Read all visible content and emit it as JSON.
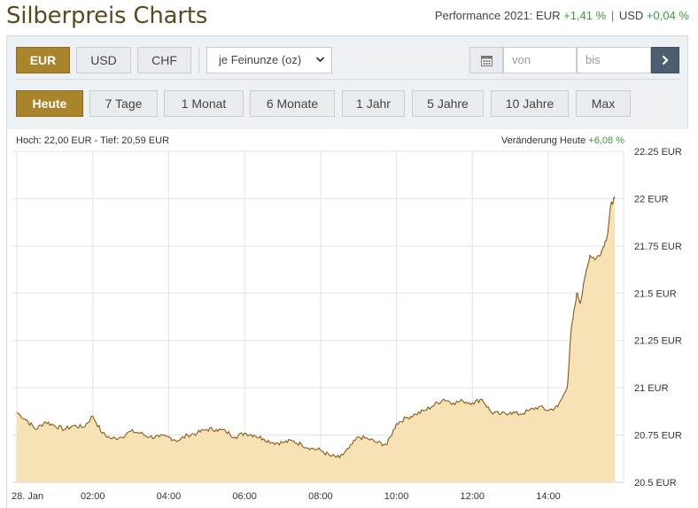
{
  "header": {
    "title": "Silberpreis Charts",
    "performance_label": "Performance 2021:",
    "eur_label": "EUR",
    "eur_value": "+1,41 %",
    "separator": "|",
    "usd_label": "USD",
    "usd_value": "+0,04 %"
  },
  "currency_buttons": [
    {
      "label": "EUR",
      "active": true
    },
    {
      "label": "USD",
      "active": false
    },
    {
      "label": "CHF",
      "active": false
    }
  ],
  "unit_select": {
    "value": "je Feinunze (oz)"
  },
  "date_range": {
    "from_placeholder": "von",
    "to_placeholder": "bis"
  },
  "range_buttons": [
    {
      "label": "Heute",
      "active": true
    },
    {
      "label": "7 Tage",
      "active": false
    },
    {
      "label": "1 Monat",
      "active": false
    },
    {
      "label": "6 Monate",
      "active": false
    },
    {
      "label": "1 Jahr",
      "active": false
    },
    {
      "label": "5 Jahre",
      "active": false
    },
    {
      "label": "10 Jahre",
      "active": false
    },
    {
      "label": "Max",
      "active": false
    }
  ],
  "colors": {
    "accent": "#a8852a",
    "line": "#8b5a1a",
    "fill": "#f6e2b4",
    "positive": "#3c9a3c"
  },
  "chart_data": {
    "type": "area",
    "hi_lo_text": "Hoch: 22,00 EUR - Tief: 20,59 EUR",
    "change_label": "Veränderung Heute",
    "change_value": "+6,08 %",
    "x_ticks": [
      "28. Jan",
      "02:00",
      "04:00",
      "06:00",
      "08:00",
      "10:00",
      "12:00",
      "14:00"
    ],
    "y_ticks": [
      "22.25 EUR",
      "22 EUR",
      "21.75 EUR",
      "21.5 EUR",
      "21.25 EUR",
      "21 EUR",
      "20.75 EUR",
      "20.5 EUR"
    ],
    "y_values": [
      22.25,
      22.0,
      21.75,
      21.5,
      21.25,
      21.0,
      20.75,
      20.5
    ],
    "x_hour_ticks": [
      0,
      2,
      4,
      6,
      8,
      10,
      12,
      14
    ],
    "xlim": [
      0,
      15.75
    ],
    "ylim": [
      20.5,
      22.25
    ],
    "grid": true,
    "x_hours": [
      0,
      0.25,
      0.5,
      0.75,
      1,
      1.25,
      1.5,
      1.75,
      2,
      2.25,
      2.5,
      2.75,
      3,
      3.25,
      3.5,
      3.75,
      4,
      4.25,
      4.5,
      4.75,
      5,
      5.25,
      5.5,
      5.75,
      6,
      6.25,
      6.5,
      6.75,
      7,
      7.25,
      7.5,
      7.75,
      8,
      8.25,
      8.5,
      8.75,
      9,
      9.25,
      9.5,
      9.75,
      10,
      10.25,
      10.5,
      10.75,
      11,
      11.25,
      11.5,
      11.75,
      12,
      12.25,
      12.5,
      12.75,
      13,
      13.25,
      13.5,
      13.75,
      14,
      14.25,
      14.5,
      14.6,
      14.75,
      14.85,
      15,
      15.1,
      15.25,
      15.4,
      15.55,
      15.65,
      15.75
    ],
    "values": [
      20.87,
      20.83,
      20.78,
      20.82,
      20.8,
      20.78,
      20.8,
      20.79,
      20.85,
      20.76,
      20.73,
      20.74,
      20.77,
      20.76,
      20.74,
      20.74,
      20.74,
      20.72,
      20.75,
      20.76,
      20.78,
      20.78,
      20.77,
      20.74,
      20.76,
      20.75,
      20.73,
      20.71,
      20.71,
      20.72,
      20.7,
      20.68,
      20.67,
      20.64,
      20.63,
      20.68,
      20.74,
      20.73,
      20.71,
      20.7,
      20.81,
      20.84,
      20.86,
      20.88,
      20.91,
      20.94,
      20.92,
      20.93,
      20.92,
      20.94,
      20.87,
      20.86,
      20.87,
      20.86,
      20.88,
      20.9,
      20.88,
      20.9,
      21.0,
      21.3,
      21.5,
      21.45,
      21.62,
      21.7,
      21.68,
      21.72,
      21.8,
      21.97,
      22.0
    ]
  }
}
